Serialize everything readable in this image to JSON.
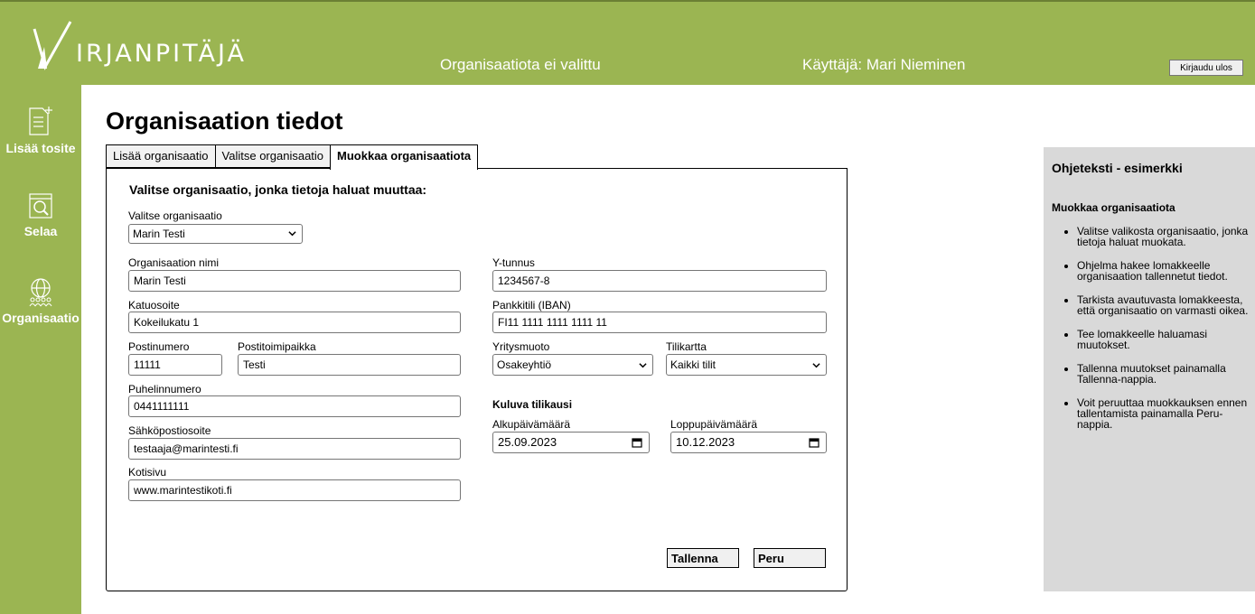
{
  "header": {
    "logo_text": "IRJANPITÄJÄ",
    "organization_status": "Organisaatiota ei valittu",
    "user_label": "Käyttäjä: Mari Nieminen",
    "logout_label": "Kirjaudu ulos"
  },
  "sidebar": {
    "items": [
      {
        "label": "Lisää tosite",
        "icon": "add-document-icon"
      },
      {
        "label": "Selaa",
        "icon": "browse-icon"
      },
      {
        "label": "Organisaatio",
        "icon": "organization-icon"
      }
    ]
  },
  "main": {
    "title": "Organisaation tiedot",
    "tabs": [
      {
        "label": "Lisää organisaatio",
        "active": false
      },
      {
        "label": "Valitse organisaatio",
        "active": false
      },
      {
        "label": "Muokkaa organisaatiota",
        "active": true
      }
    ],
    "form": {
      "heading": "Valitse organisaatio, jonka tietoja haluat muuttaa:",
      "select_org_label": "Valitse organisaatio",
      "select_org_value": "Marin Testi",
      "name_label": "Organisaation nimi",
      "name_value": "Marin Testi",
      "street_label": "Katuosoite",
      "street_value": "Kokeilukatu 1",
      "postal_code_label": "Postinumero",
      "postal_code_value": "11111",
      "city_label": "Postitoimipaikka",
      "city_value": "Testi",
      "phone_label": "Puhelinnumero",
      "phone_value": "0441111111",
      "email_label": "Sähköpostiosoite",
      "email_value": "testaaja@marintesti.fi",
      "website_label": "Kotisivu",
      "website_value": "www.marintestikoti.fi",
      "business_id_label": "Y-tunnus",
      "business_id_value": "1234567-8",
      "iban_label": "Pankkitili (IBAN)",
      "iban_value": "FI11 1111 1111 1111 11",
      "company_form_label": "Yritysmuoto",
      "company_form_value": "Osakeyhtiö",
      "chart_of_accounts_label": "Tilikartta",
      "chart_of_accounts_value": "Kaikki tilit",
      "fiscal_period_heading": "Kuluva tilikausi",
      "start_date_label": "Alkupäivämäärä",
      "start_date_value": "25.09.2023",
      "end_date_label": "Loppupäivämäärä",
      "end_date_value": "10.12.2023",
      "save_label": "Tallenna",
      "cancel_label": "Peru"
    }
  },
  "help": {
    "title": "Ohjeteksti - esimerkki",
    "subtitle": "Muokkaa organisaatiota",
    "items": [
      "Valitse valikosta organisaatio, jonka tietoja haluat muokata.",
      "Ohjelma hakee lomakkeelle organisaation tallennetut tiedot.",
      "Tarkista avautuvasta lomakkeesta, että organisaatio on varmasti oikea.",
      "Tee lomakkeelle haluamasi muutokset.",
      "Tallenna muutokset painamalla Tallenna-nappia.",
      "Voit peruuttaa muokkauksen ennen tallentamista painamalla Peru-nappia."
    ]
  },
  "colors": {
    "brand_green": "#9bb552",
    "help_panel": "#d9d9d9"
  }
}
